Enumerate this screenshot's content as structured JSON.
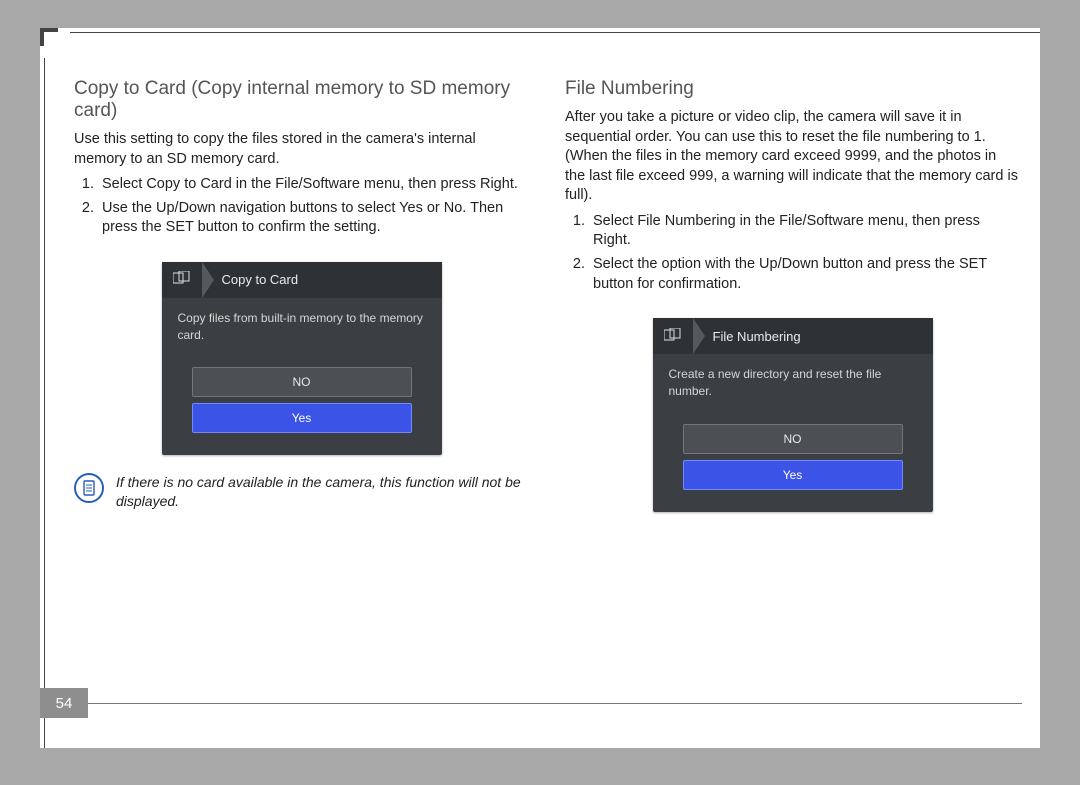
{
  "page_number": "54",
  "left": {
    "heading": "Copy to Card (Copy internal memory to SD memory card)",
    "intro": "Use this setting to copy the files stored in the camera's internal memory to an SD memory card.",
    "steps": [
      "Select Copy to Card in the File/Software menu, then press Right.",
      "Use the Up/Down navigation buttons to select Yes or No. Then press the SET button to confirm the setting."
    ],
    "camera": {
      "title": "Copy to Card",
      "desc": "Copy files from built-in memory to the memory card.",
      "options": [
        "NO",
        "Yes"
      ],
      "selected": 1
    },
    "note": "If there is no card available in the camera, this function will not be displayed."
  },
  "right": {
    "heading": "File Numbering",
    "intro": "After you take a picture or video clip, the camera will save it in sequential order. You can use this to reset the file numbering to 1. (When the files in the memory card exceed 9999, and the photos in the last file exceed 999, a warning will indicate that the memory card is full).",
    "steps": [
      "Select File Numbering in the File/Software menu, then press Right.",
      "Select the option with the Up/Down button and press the SET button for confirmation."
    ],
    "camera": {
      "title": "File Numbering",
      "desc": "Create a new directory and reset the file number.",
      "options": [
        "NO",
        "Yes"
      ],
      "selected": 1
    }
  }
}
